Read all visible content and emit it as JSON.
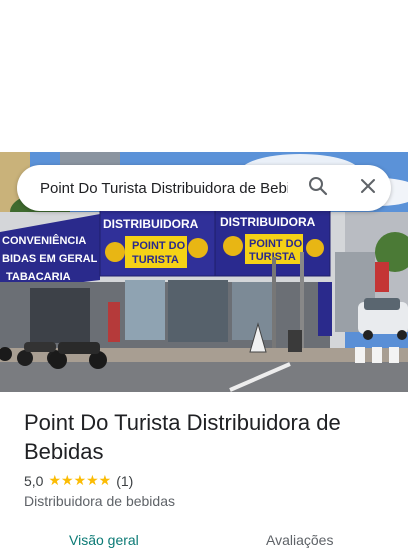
{
  "search": {
    "value": "Point Do Turista Distribuidora de Bebidas"
  },
  "photo": {
    "storefront_signs": [
      "CONVENIÊNCIA",
      "BIDAS EM GERAL",
      "TABACARIA",
      "DISTRIBUIDORA",
      "POINT DO",
      "TURISTA",
      "DISTRIBUIDORA",
      "POINT DO",
      "TURISTA"
    ]
  },
  "place": {
    "name": "Point Do Turista Distribuidora de Bebidas",
    "rating": "5,0",
    "stars": "★★★★★",
    "review_count": "(1)",
    "category": "Distribuidora de bebidas"
  },
  "tabs": [
    {
      "label": "Visão geral",
      "active": true
    },
    {
      "label": "Avaliações",
      "active": false
    }
  ],
  "colors": {
    "active_tab": "#0b7a75",
    "star": "#fbbc04",
    "sign_blue": "#2a2a8c",
    "sign_yellow": "#f5d216"
  }
}
